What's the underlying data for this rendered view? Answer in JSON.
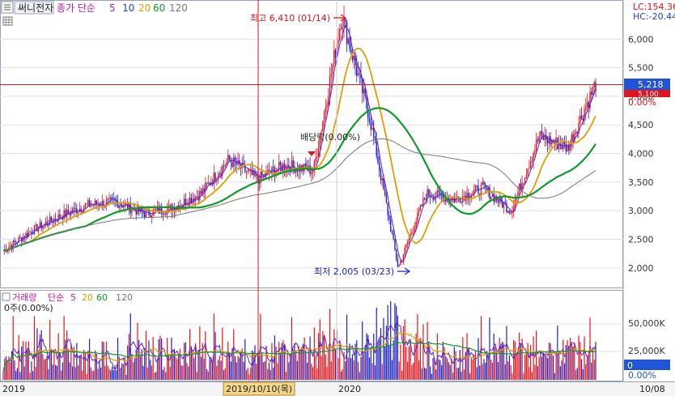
{
  "header": {
    "stock_name": "써니전자",
    "price_legend_prefix": "종가 단순",
    "ma_labels": [
      "5",
      "10",
      "20",
      "60",
      "120"
    ]
  },
  "corner": {
    "lc": "LC:154.36",
    "hc": "HC:-20.44"
  },
  "volume_header": {
    "title": "거래량",
    "mode": "단순",
    "ma_labels": [
      "5",
      "20",
      "60",
      "120"
    ]
  },
  "volume_info": "0주(0.00%)",
  "annotations": {
    "high": "최고 6,410 (01/14)",
    "low": "최저 2,005 (03/23)",
    "dividend": "배당락(0.00%)",
    "cursor_date": "2019/10/10(목)"
  },
  "price_tags": {
    "current": "5,218",
    "secondary": "5,100",
    "pct": "0.00%"
  },
  "volume_tags": {
    "current": "0",
    "pct": "0.00%"
  },
  "x_axis": {
    "left_label": "2019",
    "mid_label": "2020",
    "right_label": "10/08"
  },
  "colors": {
    "up": "#e8141b",
    "down": "#1a22c8",
    "ma5": "#5a1fd6",
    "ma10": "#1f3fcc",
    "ma20": "#e0a000",
    "ma60": "#0f9a2a",
    "ma120": "#777777",
    "cursor": "#e0141b",
    "tag_bg": "#1f55d6"
  },
  "chart_data": [
    {
      "type": "line",
      "title": "써니전자",
      "y_ticks": [
        "6,000",
        "5,500",
        "5,000",
        "4,500",
        "4,000",
        "3,500",
        "3,000",
        "2,500",
        "2,000"
      ],
      "ylim": [
        1700,
        6400
      ],
      "x_ticks": [
        "2019",
        "2020",
        "10/08"
      ],
      "price_path": [
        [
          "2019-01",
          2300
        ],
        [
          "2019-02",
          2650
        ],
        [
          "2019-03",
          2900
        ],
        [
          "2019-04",
          3100
        ],
        [
          "2019-05",
          3150
        ],
        [
          "2019-06",
          2950
        ],
        [
          "2019-07",
          3050
        ],
        [
          "2019-08",
          3300
        ],
        [
          "2019-09",
          3900
        ],
        [
          "2019-10",
          3550
        ],
        [
          "2019-11",
          3800
        ],
        [
          "2019-12",
          3700
        ],
        [
          "2020-01",
          6410
        ],
        [
          "2020-02",
          4600
        ],
        [
          "2020-03",
          2005
        ],
        [
          "2020-04",
          3300
        ],
        [
          "2020-05",
          3200
        ],
        [
          "2020-06",
          3400
        ],
        [
          "2020-07",
          3000
        ],
        [
          "2020-08",
          4300
        ],
        [
          "2020-09",
          4100
        ],
        [
          "2020-10",
          5218
        ]
      ],
      "ma_path": [
        [
          "2019-01",
          2250
        ],
        [
          "2019-04",
          2900
        ],
        [
          "2019-07",
          2950
        ],
        [
          "2019-10",
          3400
        ],
        [
          "2019-12",
          3600
        ],
        [
          "2020-01",
          4300
        ],
        [
          "2020-03",
          4500
        ],
        [
          "2020-05",
          3500
        ],
        [
          "2020-07",
          3300
        ],
        [
          "2020-08",
          3600
        ],
        [
          "2020-10",
          4000
        ]
      ],
      "legend": [
        "5",
        "10",
        "20",
        "60",
        "120"
      ]
    },
    {
      "type": "bar",
      "title": "거래량",
      "y_ticks": [
        "50,000K",
        "25,000K"
      ],
      "x_ticks": [
        "2019",
        "2020",
        "10/08"
      ]
    }
  ]
}
